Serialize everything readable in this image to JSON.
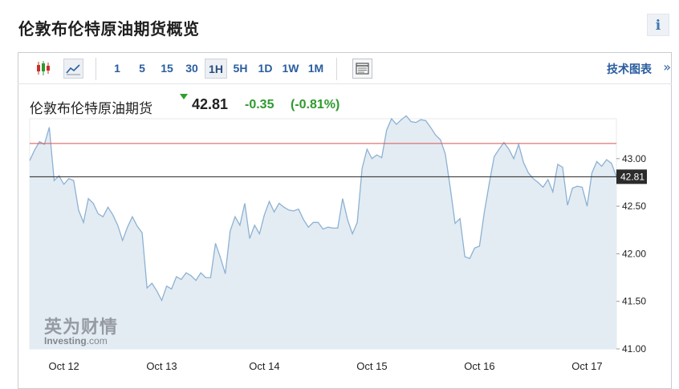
{
  "page_title": "伦敦布伦特原油期货概览",
  "info_label": "i",
  "toolbar": {
    "chart_types": [
      {
        "name": "candlestick-chart-icon",
        "active": false
      },
      {
        "name": "line-chart-icon",
        "active": true
      }
    ],
    "intervals": [
      {
        "label": "1",
        "active": false
      },
      {
        "label": "5",
        "active": false
      },
      {
        "label": "15",
        "active": false
      },
      {
        "label": "30",
        "active": false
      },
      {
        "label": "1H",
        "active": true
      },
      {
        "label": "5H",
        "active": false
      },
      {
        "label": "1D",
        "active": false
      },
      {
        "label": "1W",
        "active": false
      },
      {
        "label": "1M",
        "active": false
      }
    ],
    "technical_chart_link": "技术图表",
    "technical_chart_arrow": "»"
  },
  "instrument": {
    "name": "伦敦布伦特原油期货",
    "price": "42.81",
    "change": "-0.35",
    "change_percent": "(-0.81%)",
    "direction": "down"
  },
  "watermark": {
    "brand_cn": "英为财情",
    "brand_en": "Investing",
    "brand_en_suffix": ".com"
  },
  "colors": {
    "line": "#8db1d3",
    "area": "#e3ecf3",
    "reference_line": "#d9534f",
    "current_line": "#222222",
    "down": "#2e9a2e",
    "link": "#2a5d9f"
  },
  "chart_data": {
    "type": "area",
    "interval": "1H",
    "x_labels": [
      "Oct 12",
      "Oct 13",
      "Oct 14",
      "Oct 15",
      "Oct 16",
      "Oct 17"
    ],
    "ylim": [
      41.0,
      43.42
    ],
    "y_ticks": [
      "43.00",
      "42.50",
      "42.00",
      "41.50",
      "41.00"
    ],
    "current_price_label": "42.81",
    "current_price": 42.81,
    "reference_price": 43.16,
    "values": [
      42.98,
      43.09,
      43.18,
      43.15,
      43.33,
      42.77,
      42.82,
      42.73,
      42.79,
      42.77,
      42.46,
      42.33,
      42.58,
      42.53,
      42.42,
      42.39,
      42.49,
      42.41,
      42.3,
      42.14,
      42.28,
      42.39,
      42.29,
      42.22,
      41.64,
      41.69,
      41.61,
      41.51,
      41.66,
      41.63,
      41.76,
      41.73,
      41.8,
      41.77,
      41.72,
      41.8,
      41.75,
      41.75,
      42.11,
      41.96,
      41.79,
      42.24,
      42.39,
      42.3,
      42.53,
      42.16,
      42.3,
      42.21,
      42.41,
      42.55,
      42.44,
      42.53,
      42.49,
      42.46,
      42.45,
      42.47,
      42.36,
      42.28,
      42.33,
      42.33,
      42.26,
      42.28,
      42.27,
      42.27,
      42.58,
      42.36,
      42.21,
      42.33,
      42.9,
      43.1,
      43.0,
      43.04,
      43.01,
      43.3,
      43.42,
      43.36,
      43.41,
      43.45,
      43.39,
      43.38,
      43.41,
      43.4,
      43.33,
      43.25,
      43.2,
      43.05,
      42.7,
      42.32,
      42.37,
      41.97,
      41.95,
      42.06,
      42.08,
      42.44,
      42.74,
      43.02,
      43.1,
      43.17,
      43.1,
      43.0,
      43.15,
      42.96,
      42.85,
      42.79,
      42.75,
      42.7,
      42.78,
      42.65,
      42.94,
      42.91,
      42.51,
      42.69,
      42.71,
      42.7,
      42.5,
      42.85,
      42.97,
      42.92,
      42.99,
      42.95,
      42.81
    ],
    "x_label_indices": [
      7,
      27,
      48,
      70,
      92,
      114
    ]
  }
}
